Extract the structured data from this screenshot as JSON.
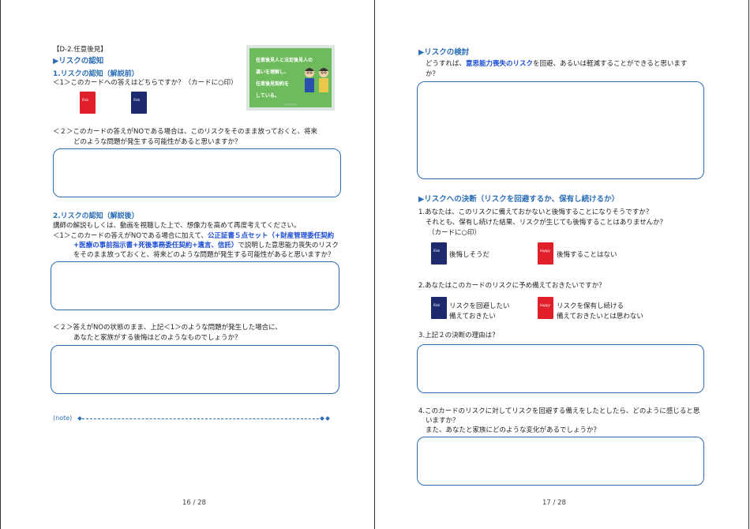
{
  "left_page": {
    "header_tag": "【D-2.任意後見】",
    "main_heading": "▶リスクの認知",
    "section1_title": "1.リスクの認知（解説前）",
    "q1": "＜1＞このカードへの答えはどちらですか？（カードに○印）",
    "q2_line1": "＜２＞このカードの答えがNOである場合は、このリスクをそのまま放っておくと、将来",
    "q2_line2": "どのような問題が発生する可能性があると思いますか？",
    "section2_title": "2.リスクの認知（解説後）",
    "instruction": "講師の解説もしくは、動画を視聴した上で、想像力を高めて再度考えてください。",
    "q3_line1_pre": "＜1＞このカードの答えがNOである場合に加えて、",
    "q3_line1_link": "公正証書５点セット（+財産管理委任契約",
    "q3_line2_link": "+医療の事前指示書+死後事務委任契約+遺言、信託）",
    "q3_line2_post": "で説明した意思能力喪失のリスク",
    "q3_line3": "をそのまま放っておくと、将来どのような問題が発生する可能性があると思いますか？",
    "q4_line1": "＜２＞答えがNOの状態のまま、上記＜1＞のような問題が発生した場合に、",
    "q4_line2": "あなたと家族がする後悔はどのようなものでしょうか？",
    "note_label": "(note)",
    "page_number": "16 / 28",
    "banner": {
      "line1": "任意後見人と法定後見人の",
      "line2": "違いを理解し、",
      "line3": "任意後見契約を",
      "line4": "している。",
      "small": "○○○○○○"
    }
  },
  "right_page": {
    "heading1": "▶リスクの検討",
    "risk_q_pre": "どうすれば、",
    "risk_q_link": "意思能力喪失のリスク",
    "risk_q_post": "を回避、あるいは軽減することができると思います",
    "risk_q_line2": "か？",
    "heading2": "▶リスクへの決断（リスクを回避するか、保有し続けるか）",
    "d1_line1": "1.あなたは、このリスクに備えておかないと後悔することになりそうですか？",
    "d1_line2": "それとも、保有し続けた結果、リスクが生じても後悔することはありませんか？",
    "d1_line3": "（カードに○印）",
    "opt1a": "後悔しそうだ",
    "opt1b": "後悔することはない",
    "d2": "2.あなたはこのカードのリスクに予め備えておきたいですか？",
    "opt2a_l1": "リスクを回避したい",
    "opt2a_l2": "備えておきたい",
    "opt2b_l1": "リスクを保有し続ける",
    "opt2b_l2": "備えておきたいとは思わない",
    "d3": "3.上記２の決断の理由は？",
    "d4_line1": "4.このカードのリスクに対してリスクを回避する備えをしたとしたら、どのように感じると思",
    "d4_line2": "いますか？",
    "d4_line3": "また、あなたと家族にどのような変化があるでしょうか？",
    "page_number": "17 / 28"
  },
  "colors": {
    "accent_blue": "#2a6db5",
    "link_blue": "#1a4bd6",
    "card_red": "#e01f2a",
    "card_navy": "#1d2a6e",
    "banner_green": "#6dbb5c"
  },
  "icons": {
    "card_red": "red-risk-card-icon",
    "card_navy": "navy-risk-card-icon"
  }
}
